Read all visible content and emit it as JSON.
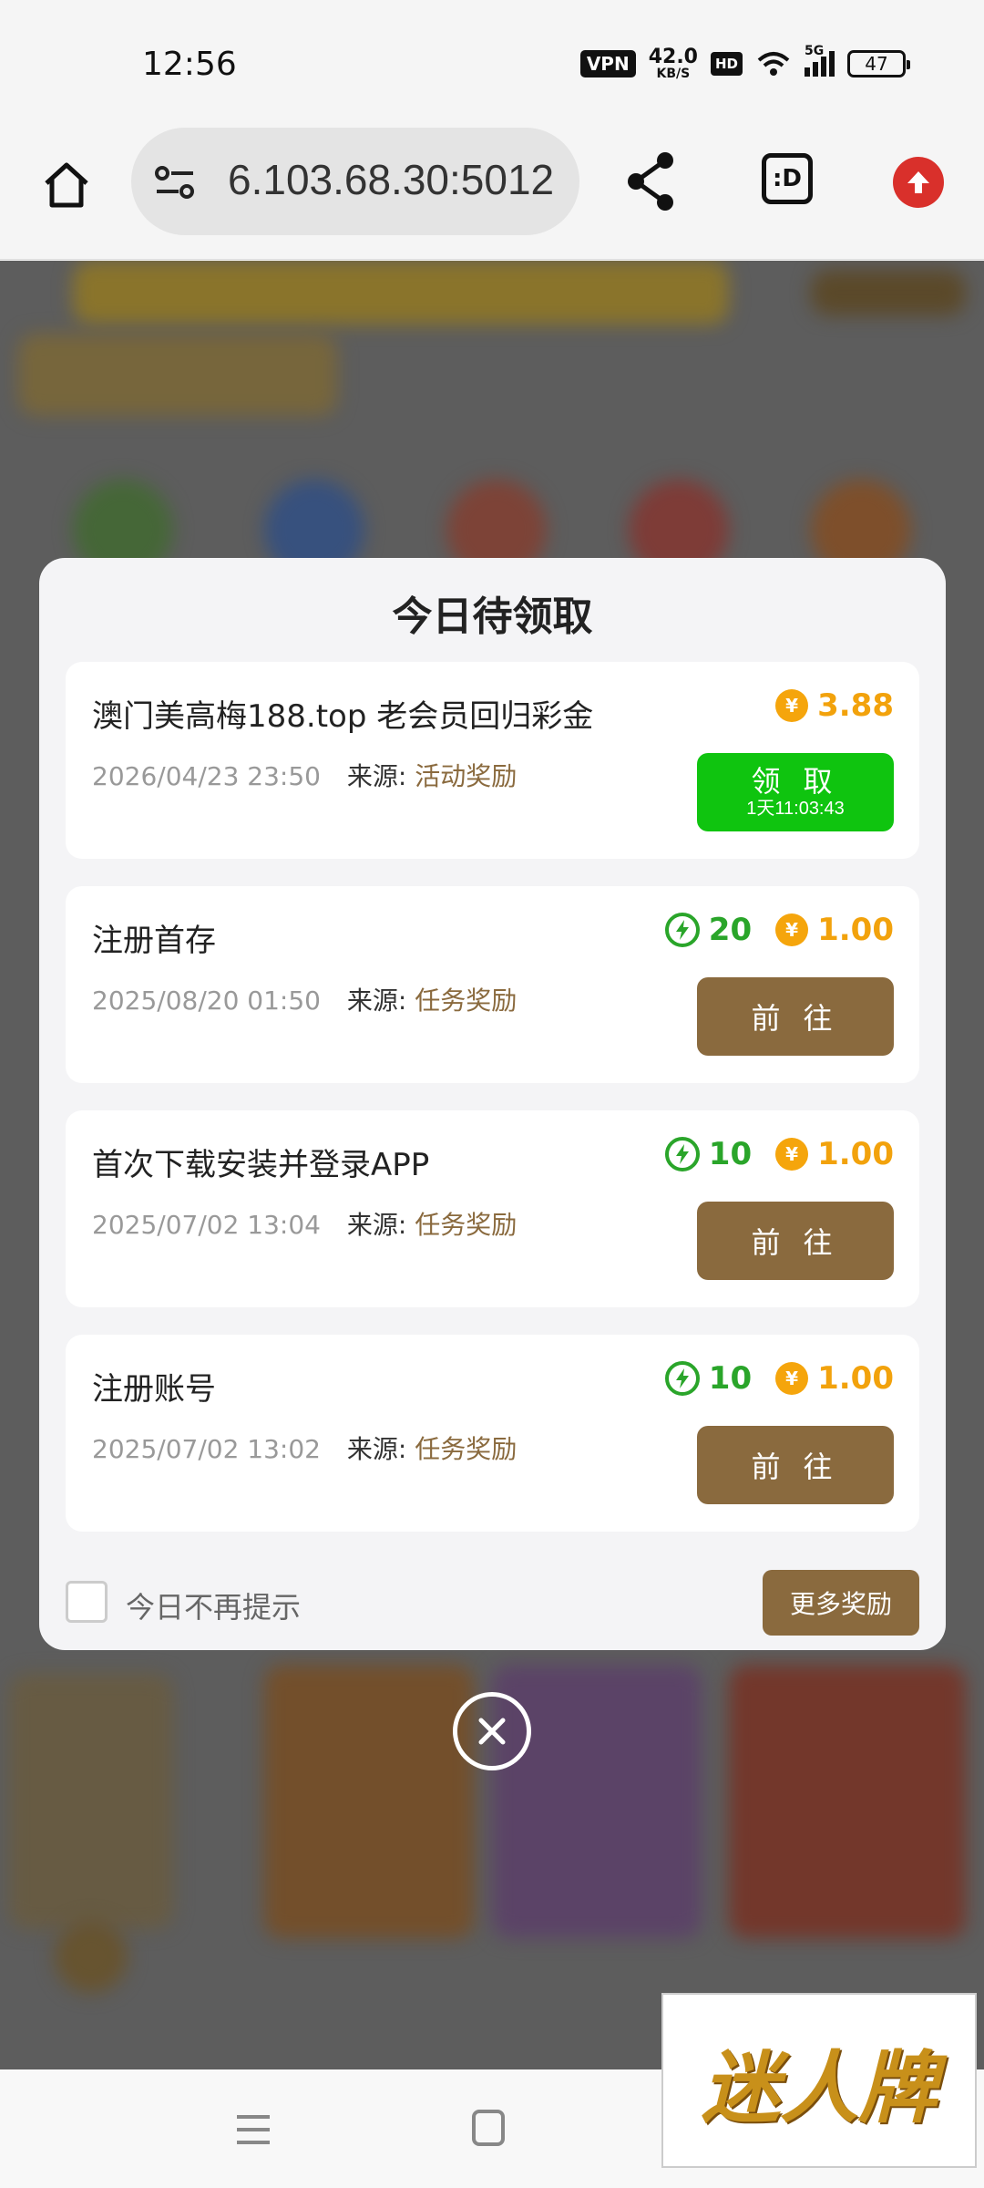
{
  "status_bar": {
    "time": "12:56",
    "vpn": "VPN",
    "net_speed_value": "42.0",
    "net_speed_unit": "KB/S",
    "hd": "HD",
    "network": "5G",
    "battery": "47"
  },
  "browser": {
    "url": "6.103.68.30:5012",
    "tabs_label": ":D"
  },
  "modal": {
    "title": "今日待领取",
    "source_label": "来源:",
    "items": [
      {
        "title": "澳门美高梅188.top 老会员回归彩金",
        "date": "2026/04/23 23:50",
        "source": "活动奖励",
        "energy": "",
        "coins": "3.88",
        "button_label": "领 取",
        "button_sub": "1天11:03:43"
      },
      {
        "title": "注册首存",
        "date": "2025/08/20 01:50",
        "source": "任务奖励",
        "energy": "20",
        "coins": "1.00",
        "button_label": "前 往"
      },
      {
        "title": "首次下载安装并登录APP",
        "date": "2025/07/02 13:04",
        "source": "任务奖励",
        "energy": "10",
        "coins": "1.00",
        "button_label": "前 往"
      },
      {
        "title": "注册账号",
        "date": "2025/07/02 13:02",
        "source": "任务奖励",
        "energy": "10",
        "coins": "1.00",
        "button_label": "前 往"
      }
    ],
    "dont_show_label": "今日不再提示",
    "more_rewards_label": "更多奖励",
    "coin_symbol": "¥"
  },
  "watermark": {
    "text": "迷人牌"
  },
  "colors": {
    "accent_brown": "#8a6a3e",
    "claim_green": "#0fc40f",
    "energy_green": "#2aa52a",
    "coin_orange": "#f2a20c"
  }
}
